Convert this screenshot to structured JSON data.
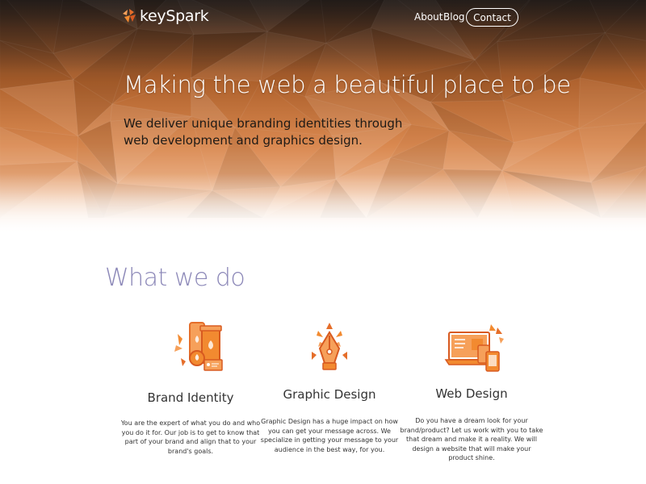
{
  "brand": {
    "name": "keySpark"
  },
  "nav": {
    "items": [
      "About",
      "Blog"
    ],
    "contact_label": "Contact"
  },
  "hero": {
    "title": "Making the web a beautiful place to be",
    "subtitle": "We deliver unique branding identities through web development and graphics design."
  },
  "section": {
    "title": "What we do"
  },
  "services": [
    {
      "title": "Brand Identity",
      "icon": "brand-identity-icon",
      "description": "You are the expert of what you do and who you do it for. Our job is to get to know that part of your brand and align that to your brand's goals."
    },
    {
      "title": "Graphic Design",
      "icon": "graphic-design-icon",
      "description": "Graphic Design has a huge impact on how you can get your message across. We specialize in getting your message to your audience in the best way, for you."
    },
    {
      "title": "Web Design",
      "icon": "web-design-icon",
      "description": "Do you have a dream look for your brand/product? Let us work with you to take that dream and make it a reality. We will design a website that will make your product shine."
    }
  ],
  "colors": {
    "accent": "#f28a30",
    "heading": "#8c88b8",
    "hero_dark": "#3b2a22"
  }
}
